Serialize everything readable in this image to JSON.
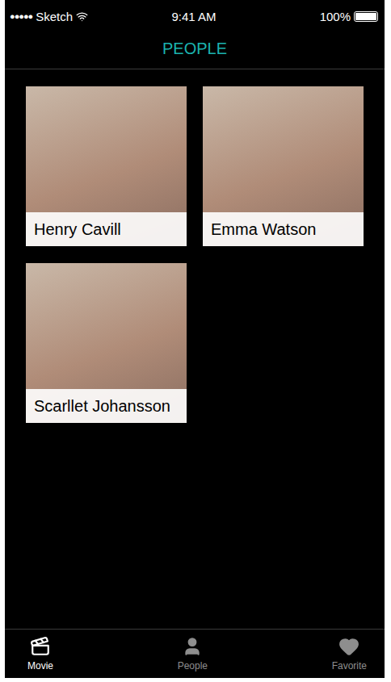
{
  "status_bar": {
    "signal": "●●●●●",
    "carrier": "Sketch",
    "time": "9:41 AM",
    "battery": "100%",
    "battery_level": 1
  },
  "header": {
    "title": "PEOPLE"
  },
  "people": [
    {
      "name": "Henry Cavill"
    },
    {
      "name": "Emma Watson"
    },
    {
      "name": "Scarllet Johansson"
    }
  ],
  "tab_bar": [
    {
      "label": "Movie",
      "selected": true
    },
    {
      "label": "People",
      "selected": false
    },
    {
      "label": "Favorite",
      "selected": false
    }
  ]
}
